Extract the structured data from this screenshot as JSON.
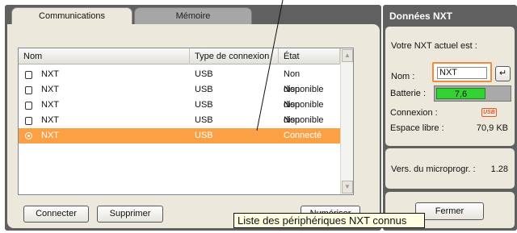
{
  "tabs": [
    {
      "label": "Communications",
      "active": true
    },
    {
      "label": "Mémoire",
      "active": false
    }
  ],
  "table": {
    "columns": [
      "Nom",
      "Type de connexion",
      "État"
    ],
    "rows": [
      {
        "name": "NXT",
        "type": "USB",
        "state": "Non disponible",
        "selected": false
      },
      {
        "name": "NXT",
        "type": "USB",
        "state": "Non disponible",
        "selected": false
      },
      {
        "name": "NXT",
        "type": "USB",
        "state": "Non disponible",
        "selected": false
      },
      {
        "name": "NXT",
        "type": "USB",
        "state": "Non disponible",
        "selected": false
      },
      {
        "name": "NXT",
        "type": "USB",
        "state": "Connecté",
        "selected": true
      }
    ]
  },
  "buttons": {
    "connect": "Connecter",
    "delete": "Supprimer",
    "scan": "Numériser",
    "close": "Fermer",
    "enter": "↵"
  },
  "tooltip": "Liste des périphériques NXT connus",
  "right_panel": {
    "title": "Données NXT",
    "current_label": "Votre NXT actuel est :",
    "name_label": "Nom :",
    "name_value": "NXT",
    "battery_label": "Batterie :",
    "battery_value": "7,6",
    "battery_level": 0.68,
    "connection_label": "Connexion :",
    "connection_badge": "USB",
    "free_space_label": "Espace libre :",
    "free_space_value": "70,9 KB",
    "firmware_label": "Vers. du microprogr. :",
    "firmware_value": "1.28"
  },
  "colors": {
    "selection": "#fba045",
    "frame": "#606060",
    "panel": "#ece9dc",
    "battery": "#35d235",
    "input_focus": "#f08a3c"
  }
}
